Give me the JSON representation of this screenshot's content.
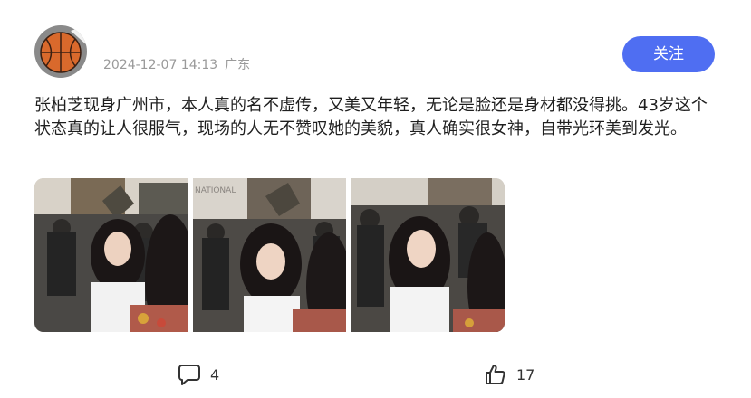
{
  "post": {
    "timestamp": "2024-12-07 14:13",
    "location": "广东",
    "follow_label": "关注",
    "text": "张柏芝现身广州市，本人真的名不虚传，又美又年轻，无论是脸还是身材都没得挑。43岁这个状态真的让人很服气，现场的人无不赞叹她的美貌，真人确实很女神，自带光环美到发光。",
    "photo_text": "NATIONAL"
  },
  "actions": {
    "comment_count": "4",
    "like_count": "17"
  },
  "colors": {
    "accent": "#4f6ef2",
    "meta_text": "#9a9a9a"
  },
  "icons": {
    "avatar": "basketball-avatar",
    "comment": "comment-icon",
    "like": "thumbs-up-icon"
  }
}
